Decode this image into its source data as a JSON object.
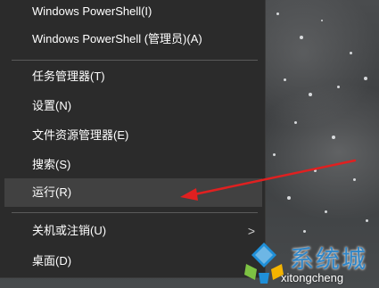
{
  "menu": {
    "items": [
      {
        "label": "Windows PowerShell(I)"
      },
      {
        "label": "Windows PowerShell (管理员)(A)"
      },
      {
        "label": "任务管理器(T)"
      },
      {
        "label": "设置(N)"
      },
      {
        "label": "文件资源管理器(E)"
      },
      {
        "label": "搜索(S)"
      },
      {
        "label": "运行(R)",
        "highlighted": true
      },
      {
        "label": "关机或注销(U)",
        "has_submenu": true,
        "submenu_glyph": ">"
      },
      {
        "label": "桌面(D)"
      }
    ]
  },
  "annotation": {
    "arrow_color": "#e02020"
  },
  "watermark": {
    "chinese": "系统城",
    "domain": "xitongcheng"
  },
  "colors": {
    "menu_background": "#2b2b2b",
    "highlight": "#414141",
    "watermark_blue": "#2f86c8"
  }
}
